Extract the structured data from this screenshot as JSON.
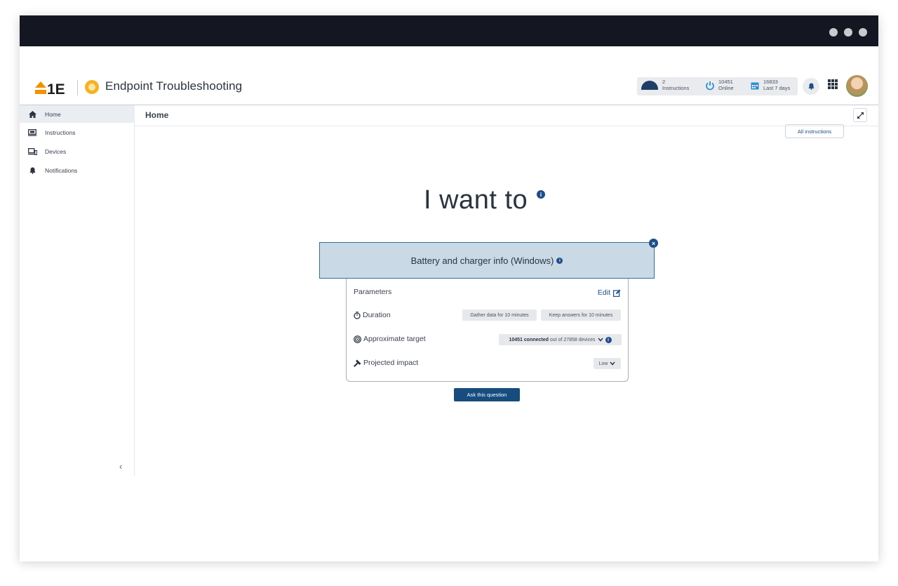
{
  "app": {
    "logo_text": "1E",
    "title": "Endpoint Troubleshooting"
  },
  "stats": {
    "instructions_count": "2",
    "instructions_label": "Instructions",
    "online_count": "10451",
    "online_label": "Online",
    "days_count": "16833",
    "days_label": "Last 7 days"
  },
  "sidebar": {
    "items": [
      {
        "label": "Home",
        "icon": "home-icon"
      },
      {
        "label": "Instructions",
        "icon": "instructions-icon"
      },
      {
        "label": "Devices",
        "icon": "devices-icon"
      },
      {
        "label": "Notifications",
        "icon": "bell-icon"
      }
    ],
    "collapse_glyph": "‹"
  },
  "header": {
    "page_title": "Home"
  },
  "main": {
    "all_instructions_label": "All instructions",
    "hero_text": "I want to",
    "instruction_title": "Battery and charger info (Windows)",
    "parameters_label": "Parameters",
    "edit_label": "Edit",
    "duration_label": "Duration",
    "gather_chip": "Gather data for 10 minutes",
    "keep_chip": "Keep answers for 10 minutes",
    "target_label": "Approximate target",
    "target_connected": "10451 connected",
    "target_rest": "out of 27858 devices",
    "impact_label": "Projected impact",
    "impact_value": "Low",
    "ask_button": "Ask this question"
  },
  "colors": {
    "titlebar": "#141622",
    "accent": "#1d4e89",
    "instruction_bg": "#c9d9e6",
    "logo_orange": "#f39200"
  }
}
